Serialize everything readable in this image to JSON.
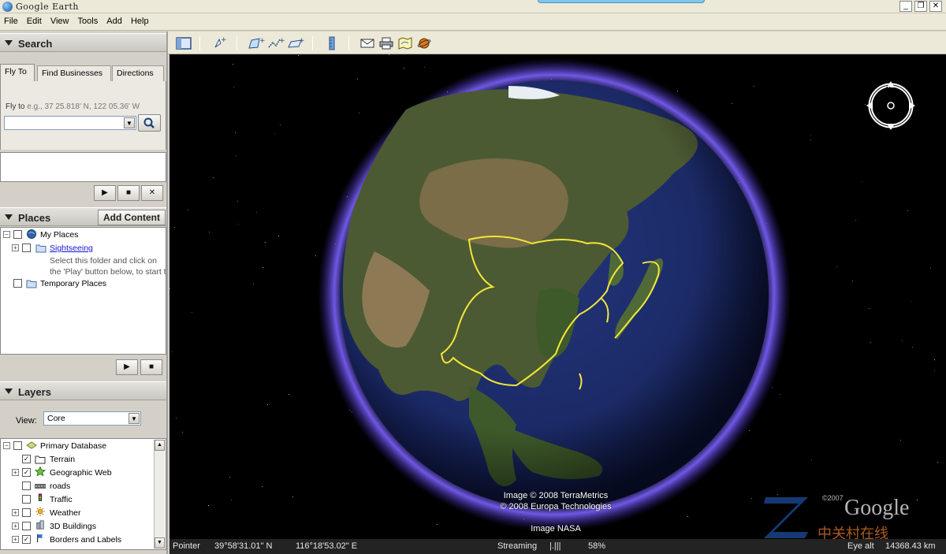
{
  "window": {
    "title": "Google Earth",
    "minimize": "_",
    "restore": "❐",
    "close": "✕"
  },
  "menu": [
    "File",
    "Edit",
    "View",
    "Tools",
    "Add",
    "Help"
  ],
  "search": {
    "header": "Search",
    "tabs": [
      "Fly To",
      "Find Businesses",
      "Directions"
    ],
    "flyto_label": "Fly to",
    "flyto_hint": "e.g., 37 25.818' N, 122 05.36' W",
    "flyto_value": ""
  },
  "places": {
    "header": "Places",
    "add_content": "Add Content",
    "items": {
      "my_places": "My Places",
      "sightseeing": "Sightseeing",
      "hint_line1": "Select this folder and click on",
      "hint_line2": "the 'Play' button below, to start th",
      "temporary": "Temporary Places"
    }
  },
  "layers": {
    "header": "Layers",
    "view_label": "View:",
    "view_value": "Core",
    "items": [
      {
        "label": "Primary Database",
        "checked": false,
        "icon": "database-icon"
      },
      {
        "label": "Terrain",
        "checked": true,
        "icon": "folder-icon"
      },
      {
        "label": "Geographic Web",
        "checked": true,
        "icon": "star-icon"
      },
      {
        "label": "roads",
        "checked": false,
        "icon": "road-icon"
      },
      {
        "label": "Traffic",
        "checked": false,
        "icon": "traffic-light-icon"
      },
      {
        "label": "Weather",
        "checked": false,
        "icon": "sun-icon"
      },
      {
        "label": "3D Buildings",
        "checked": false,
        "icon": "building-icon"
      },
      {
        "label": "Borders and Labels",
        "checked": true,
        "icon": "flag-icon"
      }
    ]
  },
  "map": {
    "attribution_line1": "Image © 2008 TerraMetrics",
    "attribution_line2": "© 2008 Europa Technologies",
    "attribution_line3": "Image NASA",
    "compass_label": "N",
    "watermark_year": "©2007",
    "watermark_brand": "Google",
    "watermark_cn": "中关村在线"
  },
  "status": {
    "pointer_label": "Pointer",
    "latitude": "39°58'31.01\" N",
    "longitude": "116°18'53.02\" E",
    "streaming_label": "Streaming",
    "streaming_bars": "|.|||",
    "streaming_percent": "58%",
    "eye_alt_label": "Eye alt",
    "eye_alt_value": "14368.43 km"
  }
}
